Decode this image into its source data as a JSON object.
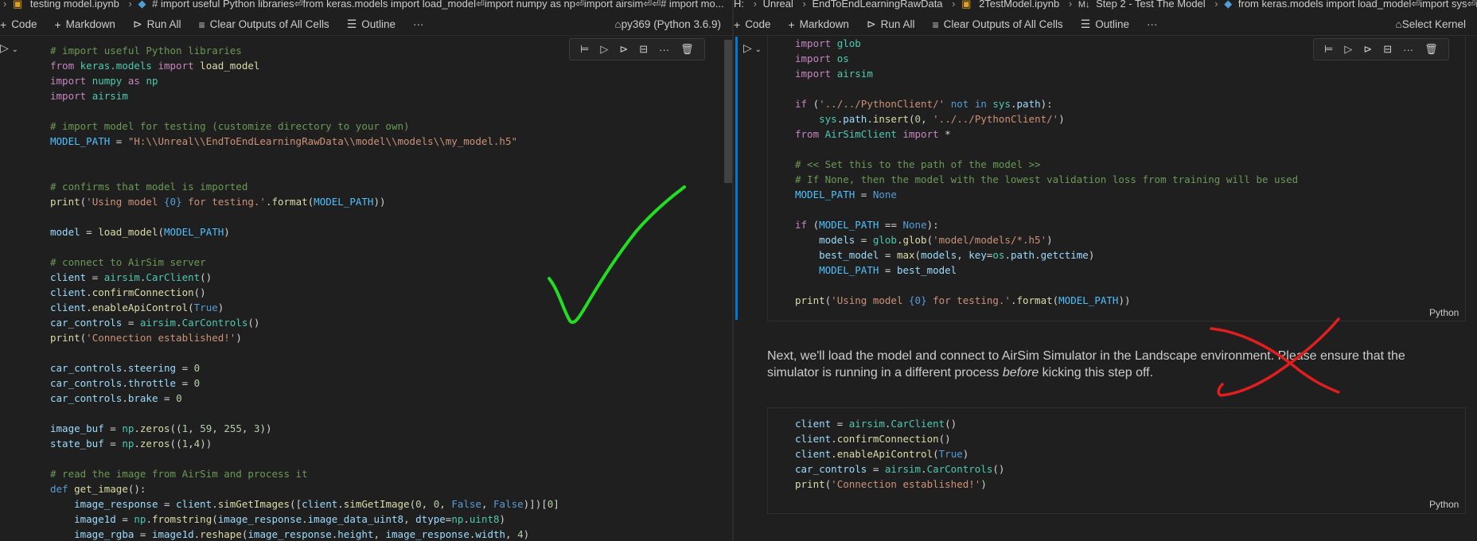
{
  "left": {
    "breadcrumb": [
      "testing model.ipynb",
      "# import useful Python libraries⏎from keras.models import load_model⏎import numpy as np⏎import airsim⏎⏎# import mo..."
    ],
    "toolbar": {
      "code": "Code",
      "markdown": "Markdown",
      "run_all": "Run All",
      "clear_outputs": "Clear Outputs of All Cells",
      "outline": "Outline",
      "more": "···",
      "kernel": "py369 (Python 3.6.9)"
    }
  },
  "right": {
    "breadcrumb": [
      "H:",
      "Unreal",
      "EndToEndLearningRawData",
      "2TestModel.ipynb",
      "Step 2 - Test The Model",
      "from keras.models import load_model⏎import sys⏎import"
    ],
    "toolbar": {
      "code": "Code",
      "markdown": "Markdown",
      "run_all": "Run All",
      "clear_outputs": "Clear Outputs of All Cells",
      "outline": "Outline",
      "more": "···",
      "kernel": "Select Kernel"
    },
    "cell1_language": "Python",
    "markdown_text_1": "Next, we'll load the model and connect to AirSim Simulator in the Landscape environment. Please ensure that the simulator is running in a different process ",
    "markdown_italic": "before",
    "markdown_text_2": " kicking this step off.",
    "cell2_language": "Python"
  },
  "colors": {
    "background": "#1f1f1f",
    "accent": "#0078d4",
    "checkmark": "#22dd22",
    "cross": "#e01e1e"
  }
}
